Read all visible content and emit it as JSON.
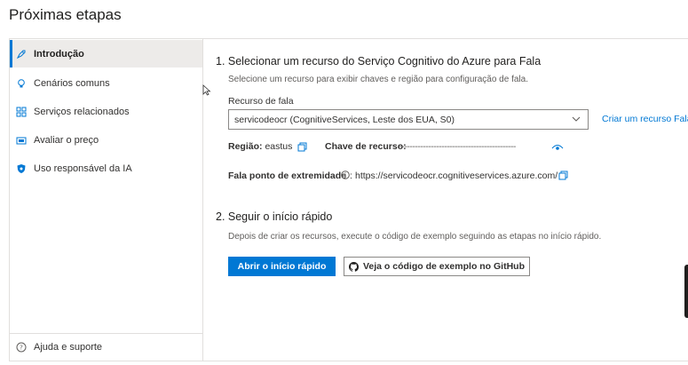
{
  "page": {
    "title": "Próximas etapas"
  },
  "sidebar": {
    "items": [
      {
        "label": "Introdução",
        "icon": "rocket-icon",
        "active": true
      },
      {
        "label": "Cenários comuns",
        "icon": "lightbulb-icon"
      },
      {
        "label": "Serviços relacionados",
        "icon": "grid-icon"
      },
      {
        "label": "Avaliar o preço",
        "icon": "price-tag-icon"
      },
      {
        "label": "Uso responsável da IA",
        "icon": "shield-icon"
      }
    ],
    "help": {
      "label": "Ajuda e suporte",
      "icon": "question-circle-icon"
    }
  },
  "section1": {
    "title": "1. Selecionar um recurso do Serviço Cognitivo do Azure para Fala",
    "subtitle": "Selecione um recurso para exibir chaves e região para configuração de fala.",
    "resource_label": "Recurso de fala",
    "resource_value": "servicodeocr (CognitiveServices, Leste dos EUA, S0)",
    "create_link": "Criar um recurso Fala",
    "region_label": "Região:",
    "region_value": "eastus",
    "key_label": "Chave de recurso:",
    "key_value": "--------------------------------------------",
    "endpoint_label": "Fala ponto de extremidade",
    "endpoint_value": "https://servicodeocr.cognitiveservices.azure.com/"
  },
  "section2": {
    "title": "2. Seguir o início rápido",
    "subtitle": "Depois de criar os recursos, execute o código de exemplo seguindo as etapas no início rápido.",
    "primary_button": "Abrir o início rápido",
    "github_button": "Veja o código de exemplo no GitHub"
  },
  "colors": {
    "accent": "#0078d4",
    "border": "#e1dfdd",
    "active_bg": "#edebe9"
  }
}
